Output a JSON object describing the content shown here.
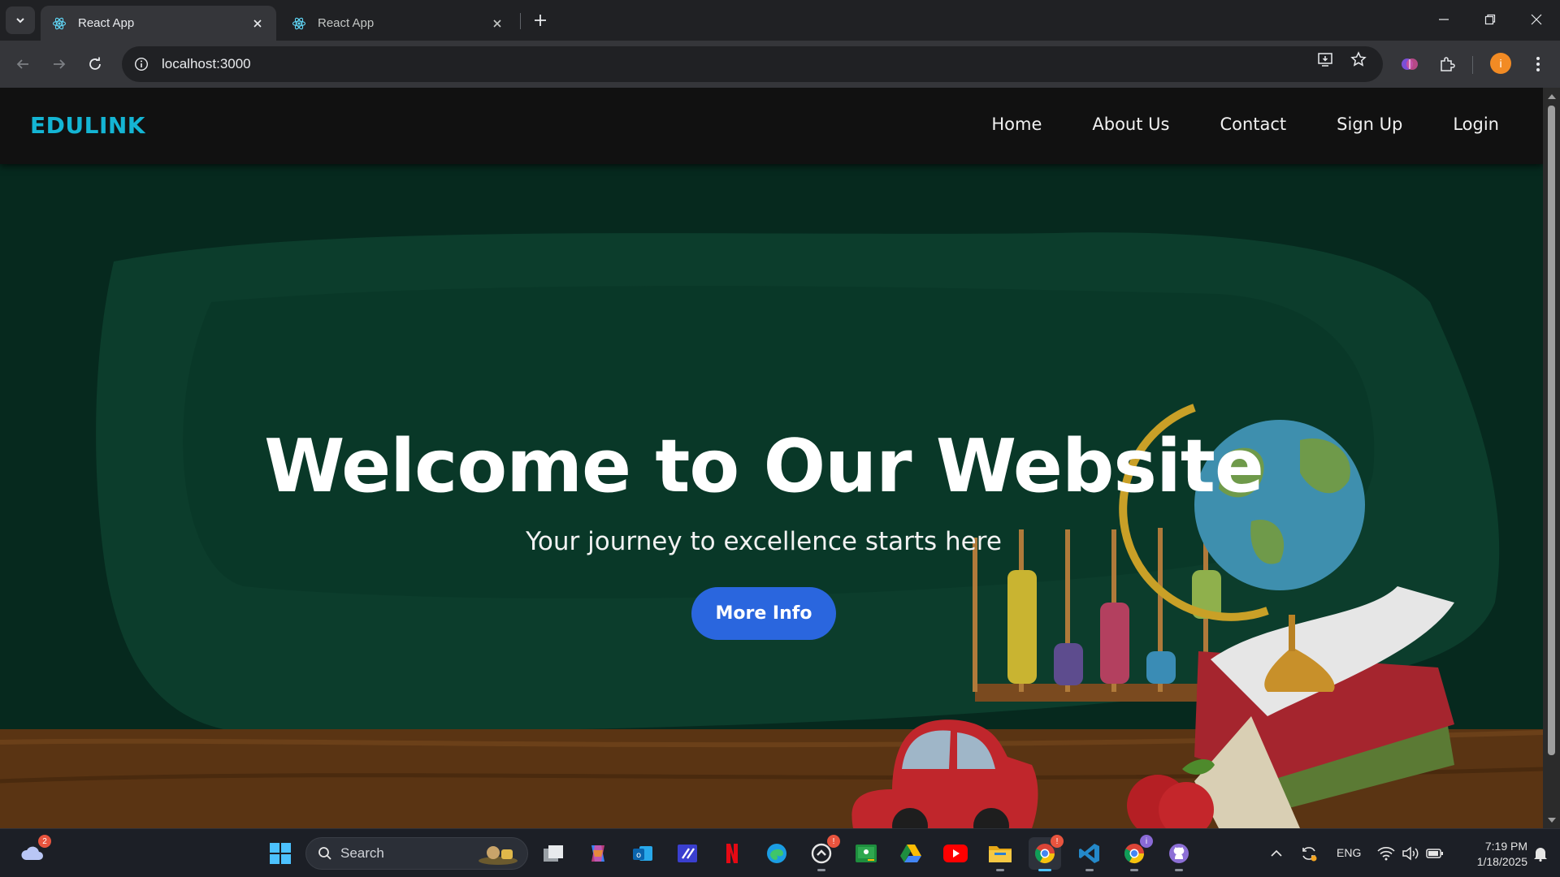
{
  "browser": {
    "tabs": [
      {
        "title": "React App",
        "active": true
      },
      {
        "title": "React App",
        "active": false
      }
    ],
    "url": "localhost:3000",
    "profile_initial": "i"
  },
  "site": {
    "brand": "EDULINK",
    "nav": [
      {
        "label": "Home"
      },
      {
        "label": "About Us"
      },
      {
        "label": "Contact"
      },
      {
        "label": "Sign Up"
      },
      {
        "label": "Login"
      }
    ],
    "hero": {
      "title": "Welcome to Our Website",
      "subtitle": "Your journey to excellence starts here",
      "button": "More Info"
    }
  },
  "taskbar": {
    "weather_badge": "2",
    "search_label": "Search",
    "apps": [
      "task-view",
      "copilot",
      "outlook",
      "teams",
      "netflix",
      "edge",
      "github-desktop",
      "google-classroom",
      "google-drive",
      "youtube",
      "file-explorer",
      "chrome",
      "vscode",
      "chrome-profile",
      "github"
    ],
    "language": "ENG",
    "time": "7:19 PM",
    "date": "1/18/2025"
  },
  "colors": {
    "brand": "#14b5d4",
    "button": "#2a66de",
    "hero_bg": "#06291e",
    "nav_bg": "#111111"
  }
}
